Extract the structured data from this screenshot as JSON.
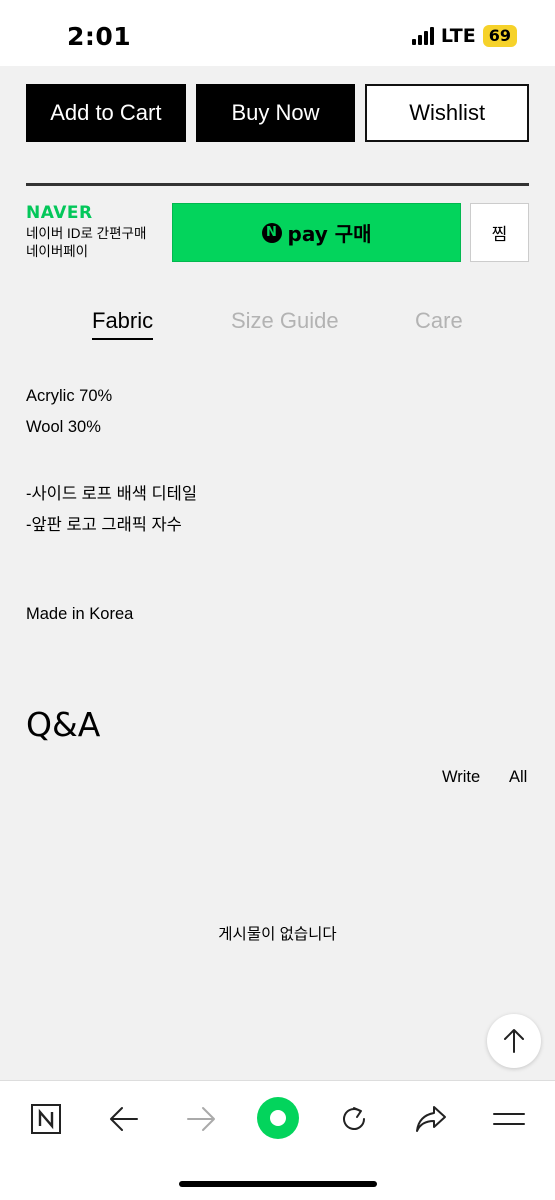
{
  "status_bar": {
    "time": "2:01",
    "network": "LTE",
    "battery": "69"
  },
  "actions": {
    "add_to_cart": "Add to Cart",
    "buy_now": "Buy Now",
    "wishlist": "Wishlist"
  },
  "naver": {
    "logo": "NAVER",
    "desc_line1": "네이버 ID로 간편구매",
    "desc_line2": "네이버페이",
    "npay_n": "N",
    "npay_label": "pay 구매",
    "zzim": "찜",
    "accent_color": "#03c75a"
  },
  "tabs": [
    {
      "label": "Fabric",
      "active": true
    },
    {
      "label": "Size Guide",
      "active": false
    },
    {
      "label": "Care",
      "active": false
    }
  ],
  "description": {
    "line1": "Acrylic 70%",
    "line2": "Wool 30%",
    "line3": "-사이드 로프 배색 디테일",
    "line4": "-앞판 로고 그래픽 자수",
    "line5": "Made in Korea"
  },
  "qa": {
    "title": "Q&A",
    "write": "Write",
    "all": "All",
    "empty": "게시물이 없습니다"
  },
  "bottom_nav": {
    "icons": [
      "naver-app-icon",
      "back-arrow-icon",
      "forward-arrow-icon",
      "green-dot-icon",
      "refresh-icon",
      "share-icon",
      "menu-icon"
    ],
    "forward_enabled": false
  }
}
